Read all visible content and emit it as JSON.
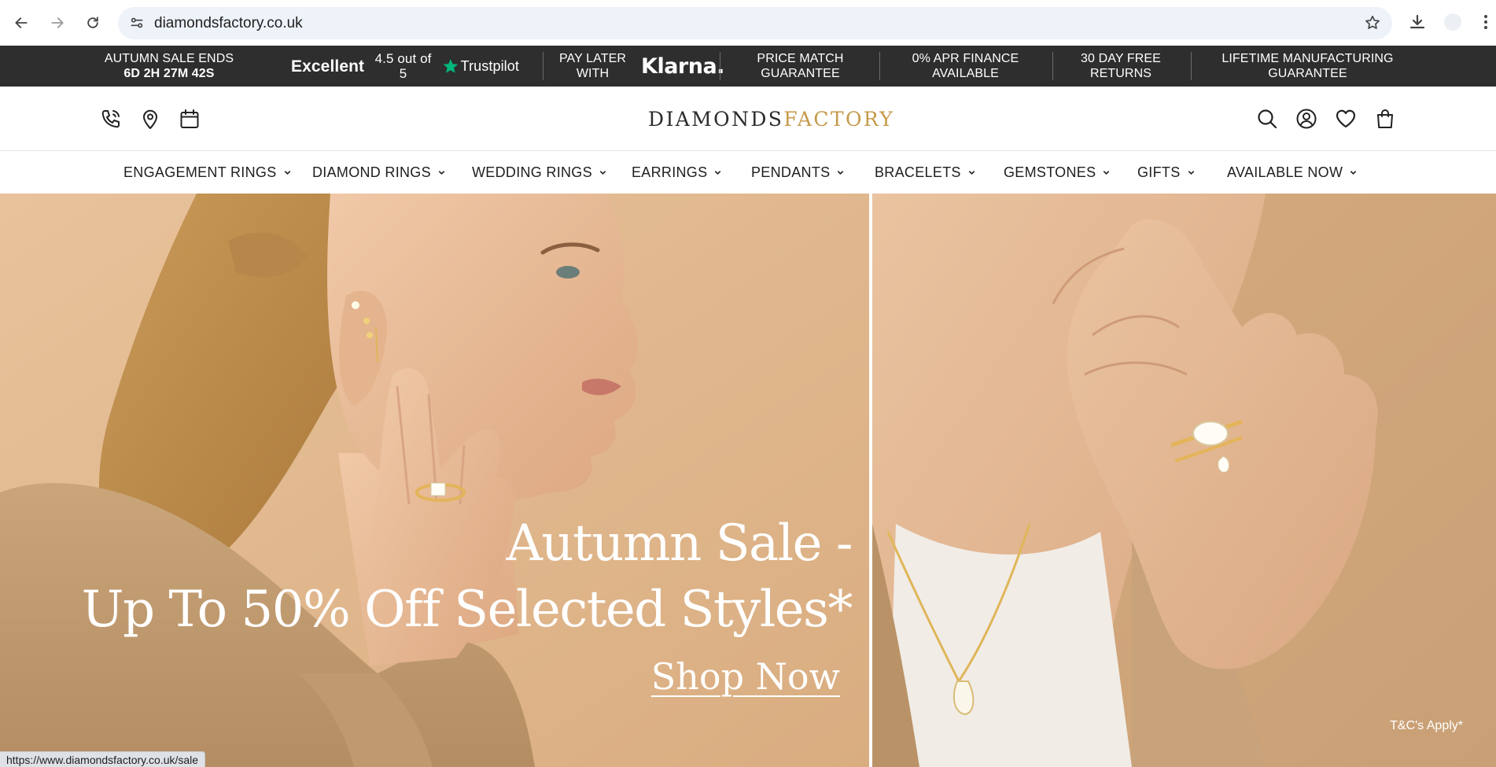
{
  "browser": {
    "url": "diamondsfactory.co.uk",
    "status_url": "https://www.diamondsfactory.co.uk/sale"
  },
  "promo": {
    "sale_line1": "AUTUMN SALE ENDS",
    "sale_countdown": "6D 2H 27M 42S",
    "trustpilot_rating_word": "Excellent",
    "trustpilot_score": "4.5 out of 5",
    "trustpilot_brand": "Trustpilot",
    "pay_later_line1": "PAY LATER",
    "pay_later_line2": "WITH",
    "klarna": "Klarna.",
    "price_match_line1": "PRICE MATCH",
    "price_match_line2": "GUARANTEE",
    "apr_line1": "0% APR FINANCE",
    "apr_line2": "AVAILABLE",
    "returns_line1": "30 DAY FREE",
    "returns_line2": "RETURNS",
    "lifetime_line1": "LIFETIME MANUFACTURING",
    "lifetime_line2": "GUARANTEE"
  },
  "header": {
    "logo_part1": "DIAMONDS",
    "logo_part2": "FACTORY"
  },
  "nav": {
    "items": [
      {
        "label": "ENGAGEMENT RINGS"
      },
      {
        "label": "DIAMOND RINGS"
      },
      {
        "label": "WEDDING RINGS"
      },
      {
        "label": "EARRINGS"
      },
      {
        "label": "PENDANTS"
      },
      {
        "label": "BRACELETS"
      },
      {
        "label": "GEMSTONES"
      },
      {
        "label": "GIFTS"
      },
      {
        "label": "AVAILABLE NOW"
      }
    ]
  },
  "hero": {
    "headline_line1": "Autumn Sale -",
    "headline_line2": "Up To 50% Off Selected Styles*",
    "cta": "Shop Now",
    "terms": "T&C's Apply*"
  },
  "colors": {
    "promo_bg": "#2e2e2e",
    "logo_gold": "#c59a4a",
    "trustpilot_green": "#00b67a",
    "hero_bg": "#e0b88f"
  }
}
